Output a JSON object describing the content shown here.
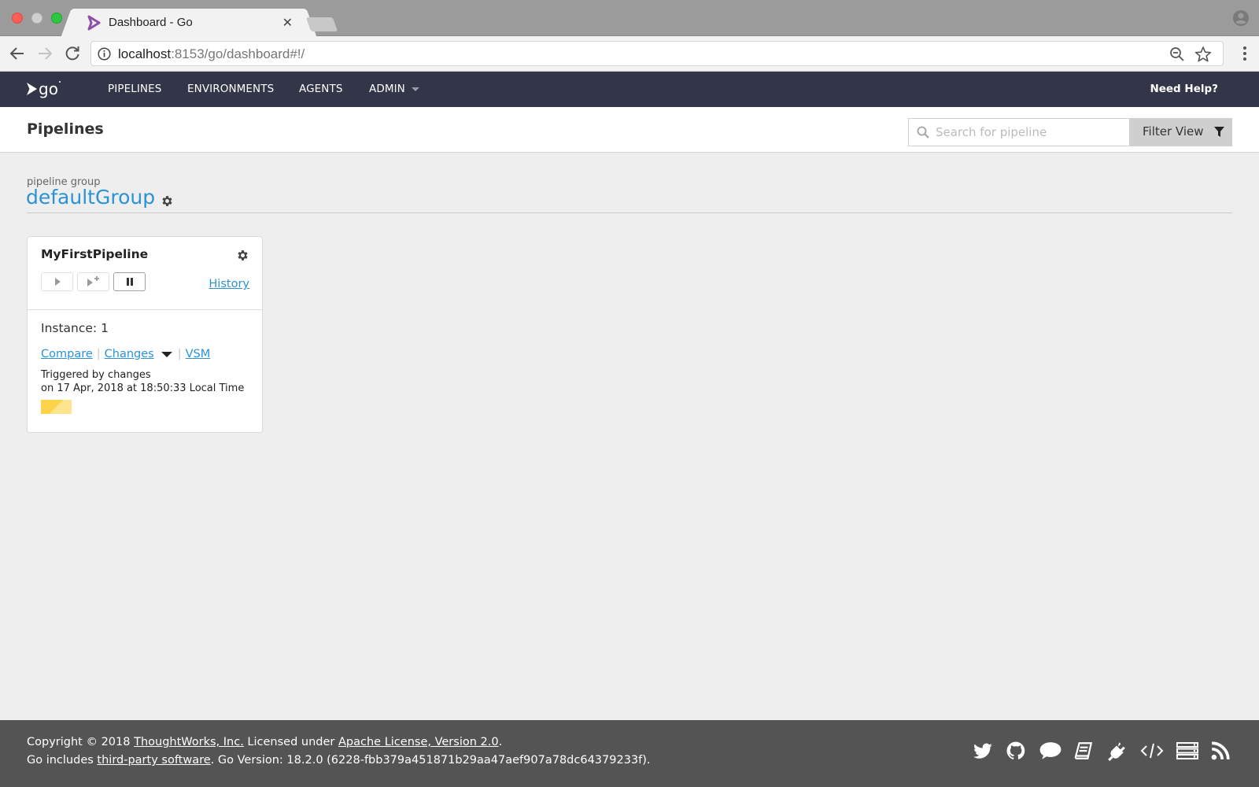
{
  "browser": {
    "tab_title": "Dashboard - Go",
    "url_host": "localhost",
    "url_rest": ":8153/go/dashboard#!/",
    "icons": [
      "back-icon",
      "forward-icon",
      "reload-icon",
      "info-icon",
      "zoom-out-icon",
      "star-icon",
      "menu-icon",
      "profile-icon"
    ]
  },
  "header": {
    "logo_text": "go",
    "nav": [
      {
        "label": "PIPELINES"
      },
      {
        "label": "ENVIRONMENTS"
      },
      {
        "label": "AGENTS"
      },
      {
        "label": "ADMIN",
        "has_dropdown": true
      }
    ],
    "help": "Need Help?"
  },
  "page": {
    "title": "Pipelines",
    "search_placeholder": "Search for pipeline",
    "search_value": "",
    "filter_label": "Filter View"
  },
  "group": {
    "label": "pipeline group",
    "name": "defaultGroup"
  },
  "pipeline": {
    "name": "MyFirstPipeline",
    "history_label": "History",
    "instance_label": "Instance: 1",
    "links": {
      "compare": "Compare",
      "changes": "Changes",
      "vsm": "VSM"
    },
    "triggered_by": "Triggered by changes",
    "triggered_on": "on 17 Apr, 2018 at 18:50:33 Local Time",
    "stage_status": "building",
    "stage_color": "#fcd34a"
  },
  "footer": {
    "line1": {
      "prefix": "Copyright © 2018 ",
      "company": "ThoughtWorks, Inc.",
      "middle": " Licensed under ",
      "license": "Apache License, Version 2.0",
      "suffix": "."
    },
    "line2": {
      "prefix": "Go includes ",
      "third_party": "third-party software",
      "suffix": ". Go Version: 18.2.0 (6228-fbb379a451871b29aa47aef907a78dc64379233f)."
    },
    "icons": [
      "twitter-icon",
      "github-icon",
      "chat-icon",
      "docs-icon",
      "plugin-icon",
      "api-icon",
      "server-icon",
      "rss-icon"
    ]
  },
  "colors": {
    "header_bg": "#333549",
    "link": "#2a93d5",
    "footer_bg": "#545454"
  }
}
